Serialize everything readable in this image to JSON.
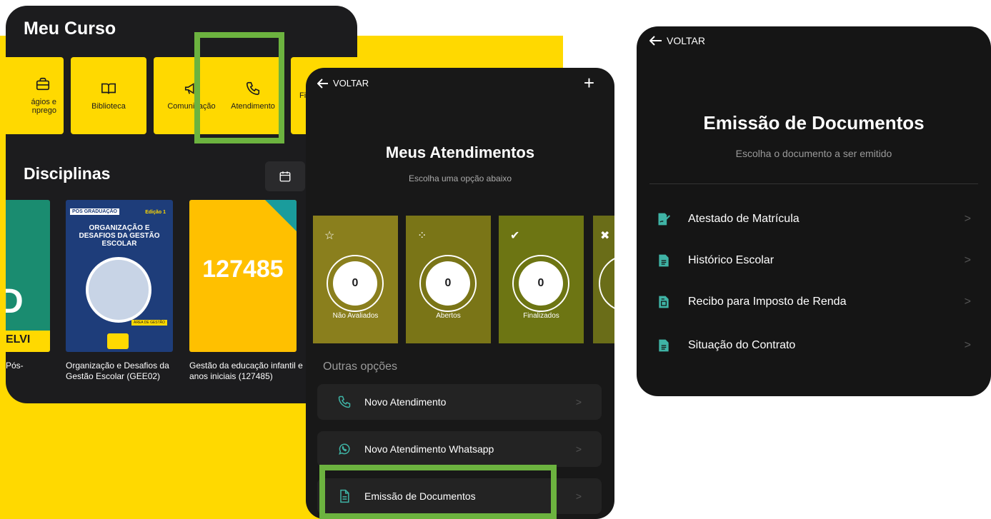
{
  "colors": {
    "yellow": "#ffd900",
    "dark": "#1c1c1e",
    "highlight_green": "#6cb33f",
    "teal_icon": "#3fb3a5"
  },
  "panel1": {
    "title": "Meu Curso",
    "tiles": [
      {
        "label": "ágios e",
        "label2": "nprego",
        "icon": "briefcase-icon"
      },
      {
        "label": "Biblioteca",
        "icon": "book-icon"
      },
      {
        "label": "Comunicação",
        "icon": "megaphone-icon"
      },
      {
        "label": "Atendimento",
        "icon": "phone-icon"
      },
      {
        "label": "Fi",
        "icon": "finance-icon"
      }
    ],
    "disciplinas_title": "Disciplinas",
    "cards": [
      {
        "big": "D",
        "strip": "ELVI",
        "caption": "Pós-"
      },
      {
        "tag": "PÓS GRADUAÇÃO",
        "edition": "Edição 1",
        "title": "ORGANIZAÇÃO E DESAFIOS DA GESTÃO ESCOLAR",
        "area": "ÁREA DE GESTÃO",
        "caption": "Organização e Desafios da Gestão Escolar (GEE02)"
      },
      {
        "number": "127485",
        "caption": "Gestão da educação infantil e anos iniciais (127485)"
      }
    ]
  },
  "panel2": {
    "back_label": "VOLTAR",
    "add_label": "+",
    "title": "Meus Atendimentos",
    "subtitle": "Escolha uma opção abaixo",
    "stats": [
      {
        "label": "Não Avaliados",
        "value": "0",
        "icon": "star-icon"
      },
      {
        "label": "Abertos",
        "value": "0",
        "icon": "spinner-icon"
      },
      {
        "label": "Finalizados",
        "value": "0",
        "icon": "check-icon"
      },
      {
        "label": "",
        "value": "",
        "icon": "x-icon"
      }
    ],
    "other_label": "Outras opções",
    "options": [
      {
        "label": "Novo Atendimento",
        "icon": "phone-icon"
      },
      {
        "label": "Novo Atendimento Whatsapp",
        "icon": "whatsapp-icon"
      },
      {
        "label": "Emissão de Documentos",
        "icon": "document-icon"
      }
    ]
  },
  "panel3": {
    "back_label": "VOLTAR",
    "title": "Emissão de Documentos",
    "subtitle": "Escolha o documento a ser emitido",
    "documents": [
      {
        "label": "Atestado de Matrícula",
        "icon": "signed-document-icon"
      },
      {
        "label": "Histórico Escolar",
        "icon": "document-icon"
      },
      {
        "label": "Recibo para Imposto de Renda",
        "icon": "receipt-icon"
      },
      {
        "label": "Situação do Contrato",
        "icon": "document-icon"
      }
    ]
  }
}
